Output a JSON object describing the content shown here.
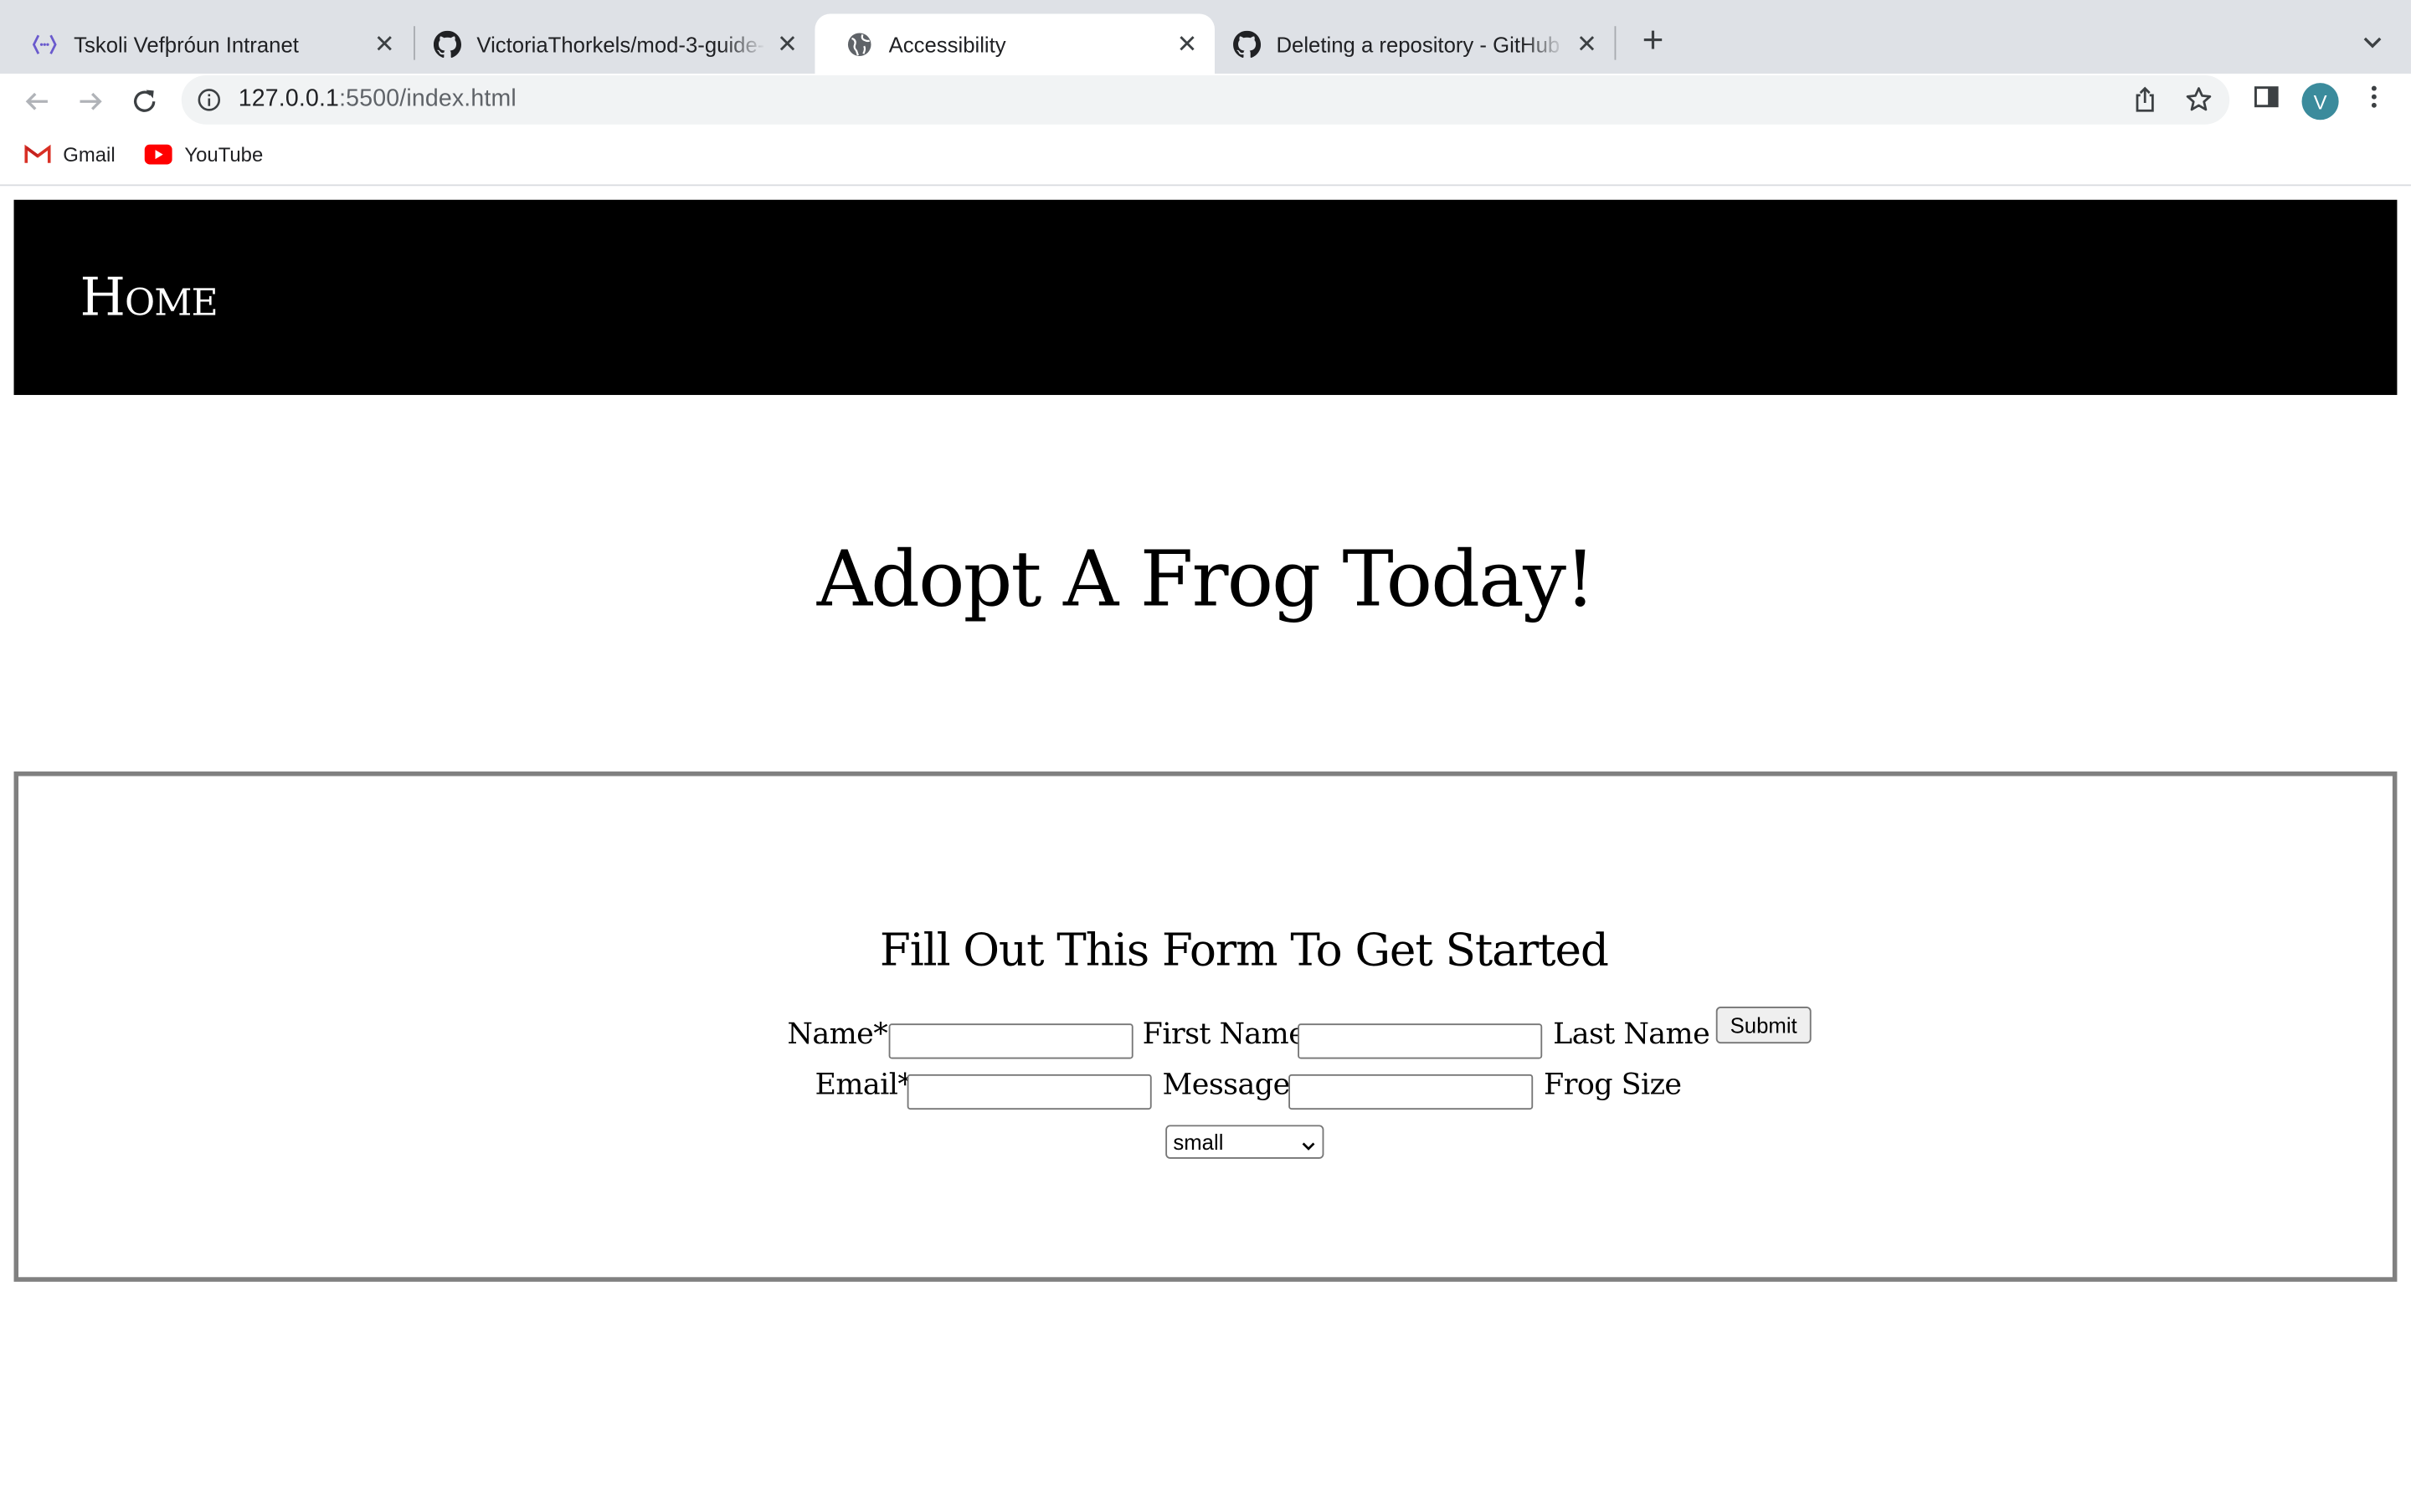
{
  "browser": {
    "tabs": [
      {
        "title": "Tskoli Vefþróun Intranet",
        "icon": "intranet-icon",
        "active": false
      },
      {
        "title": "VictoriaThorkels/mod-3-guide-",
        "icon": "github-icon",
        "active": false
      },
      {
        "title": "Accessibility",
        "icon": "globe-icon",
        "active": true
      },
      {
        "title": "Deleting a repository - GitHub",
        "icon": "github-icon",
        "active": false
      }
    ],
    "url_host": "127.0.0.1",
    "url_path": ":5500/index.html",
    "profile_initial": "V",
    "bookmarks": [
      {
        "label": "Gmail",
        "icon": "gmail-icon"
      },
      {
        "label": "YouTube",
        "icon": "youtube-icon"
      }
    ]
  },
  "page": {
    "nav_home": "Home",
    "heading": "Adopt A Frog Today!",
    "form": {
      "title": "Fill Out This Form To Get Started",
      "name_label": "Name*",
      "first_name_label": "First Name",
      "last_name_label": "Last Name",
      "submit_label": "Submit",
      "email_label": "Email*",
      "message_label": "Message",
      "frog_size_label": "Frog Size",
      "frog_size_value": "small"
    }
  },
  "colors": {
    "tabstrip": "#dee1e6",
    "header_bg": "#000000",
    "form_border": "#808080",
    "avatar": "#3b8b9c"
  }
}
